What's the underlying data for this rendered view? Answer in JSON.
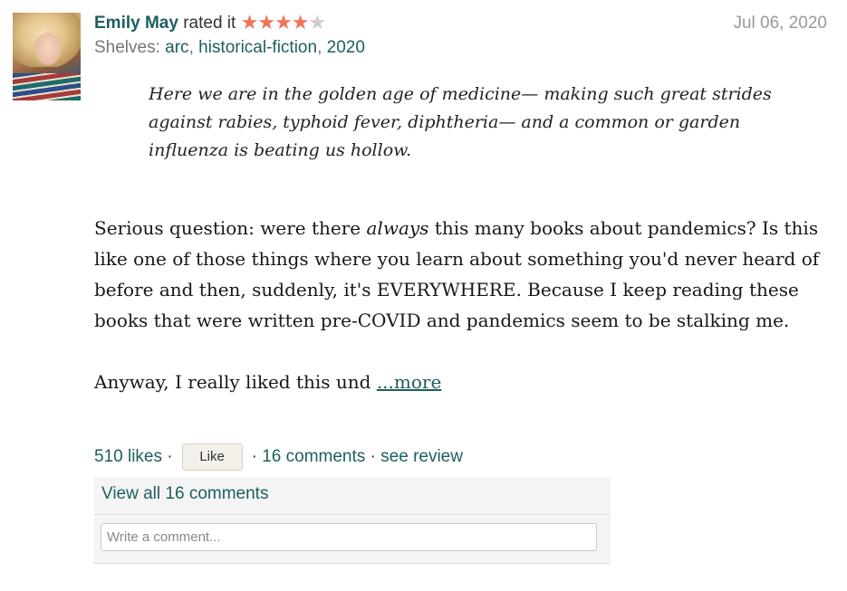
{
  "review": {
    "username": "Emily May",
    "rated_text": " rated it ",
    "rating": 4,
    "rating_max": 5,
    "date": "Jul 06, 2020",
    "shelves_label": "Shelves: ",
    "shelves": [
      "arc",
      "historical-fiction",
      "2020"
    ],
    "quote": "Here we are in the golden age of medicine— making such great strides against rabies, typhoid fever, diphtheria— and a common or garden influenza is beating us hollow.",
    "body_p1_pre": "Serious question: were there ",
    "body_p1_em": "always",
    "body_p1_post": " this many books about pandemics? Is this like one of those things where you learn about something you'd never heard of before and then, suddenly, it's EVERYWHERE. Because I keep reading these books that were written pre-COVID and pandemics seem to be stalking me.",
    "body_p2": "Anyway, I really liked this und ",
    "more_label": "...more"
  },
  "actions": {
    "likes": "510 likes",
    "like_button": "Like",
    "comments": "16 comments",
    "see_review": "see review"
  },
  "comments_box": {
    "view_all": "View all 16 comments",
    "input_placeholder": "Write a comment..."
  },
  "colors": {
    "link": "#1e5e5e",
    "star_on": "#f07455",
    "star_off": "#cccccc"
  },
  "icons": {
    "star": "star-icon"
  }
}
